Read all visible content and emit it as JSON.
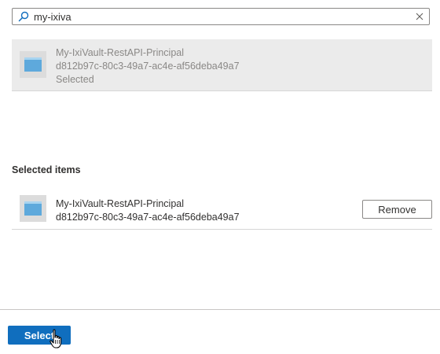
{
  "search": {
    "value": "my-ixiva",
    "icon": "search-icon",
    "clear_icon": "close-icon"
  },
  "results": [
    {
      "name": "My-IxiVault-RestAPI-Principal",
      "id": "d812b97c-80c3-49a7-ac4e-af56deba49a7",
      "status": "Selected",
      "icon": "app-registration-icon"
    }
  ],
  "selected_section": {
    "heading": "Selected items",
    "items": [
      {
        "name": "My-IxiVault-RestAPI-Principal",
        "id": "d812b97c-80c3-49a7-ac4e-af56deba49a7",
        "remove_label": "Remove",
        "icon": "app-registration-icon"
      }
    ]
  },
  "footer": {
    "select_label": "Select"
  },
  "colors": {
    "primary": "#106ebe",
    "selected_bg": "#ebebeb",
    "muted_text": "#8a8886",
    "app_icon_blue": "#5ea9dc"
  }
}
